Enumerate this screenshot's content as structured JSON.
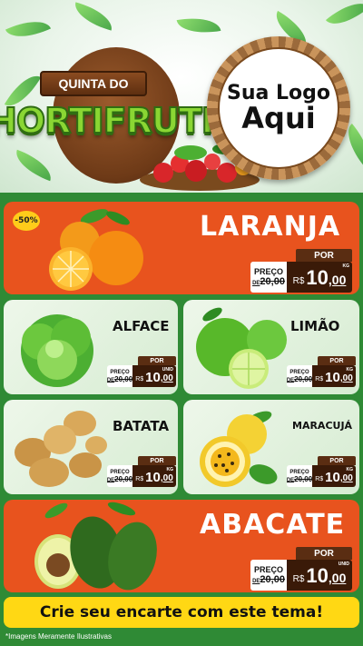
{
  "header": {
    "brand_top": "QUINTA DO",
    "brand_main": "HORTIFRUTI",
    "logo_line1": "Sua Logo",
    "logo_line2": "Aqui"
  },
  "colors": {
    "orange_card": "#e8531e",
    "green_bg": "#2f8a35",
    "cta_yellow": "#ffd814",
    "tag_dark": "#3a1a08"
  },
  "products": {
    "laranja": {
      "name": "LARANJA",
      "badge": "-50%",
      "por": "POR",
      "preco": "PREÇO",
      "de": "DE",
      "old": "20,00",
      "currency": "R$",
      "price_int": "10",
      "price_cents": ",00",
      "unit": "KG"
    },
    "alface": {
      "name": "ALFACE",
      "por": "POR",
      "preco": "PREÇO",
      "de": "DE",
      "old": "20,00",
      "currency": "R$",
      "price_int": "10",
      "price_cents": ",00",
      "unit": "UNID"
    },
    "limao": {
      "name": "LIMÃO",
      "por": "POR",
      "preco": "PREÇO",
      "de": "DE",
      "old": "20,00",
      "currency": "R$",
      "price_int": "10",
      "price_cents": ",00",
      "unit": "KG"
    },
    "batata": {
      "name": "BATATA",
      "por": "POR",
      "preco": "PREÇO",
      "de": "DE",
      "old": "20,00",
      "currency": "R$",
      "price_int": "10",
      "price_cents": ",00",
      "unit": "KG"
    },
    "maracuja": {
      "name": "MARACUJÁ",
      "por": "POR",
      "preco": "PREÇO",
      "de": "DE",
      "old": "20,00",
      "currency": "R$",
      "price_int": "10",
      "price_cents": ",00",
      "unit": "KG"
    },
    "abacate": {
      "name": "ABACATE",
      "por": "POR",
      "preco": "PREÇO",
      "de": "DE",
      "old": "20,00",
      "currency": "R$",
      "price_int": "10",
      "price_cents": ",00",
      "unit": "UNID"
    }
  },
  "footer": {
    "cta": "Crie seu encarte com este tema!",
    "disclaimer": "*Imagens Meramente Ilustrativas"
  }
}
